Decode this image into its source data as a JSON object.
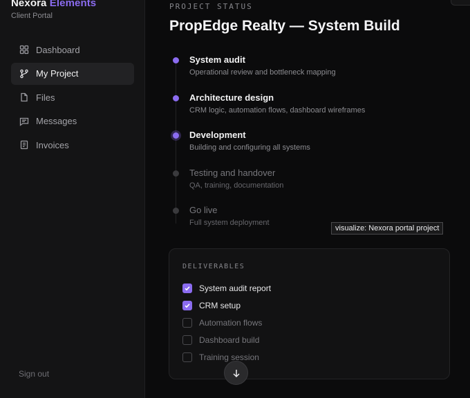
{
  "brand": {
    "name": "Nexora",
    "accent_name": "Elements",
    "subtitle": "Client Portal"
  },
  "nav": {
    "items": [
      {
        "label": "Dashboard",
        "icon": "grid-icon",
        "active": false
      },
      {
        "label": "My Project",
        "icon": "branch-icon",
        "active": true
      },
      {
        "label": "Files",
        "icon": "file-icon",
        "active": false
      },
      {
        "label": "Messages",
        "icon": "message-icon",
        "active": false
      },
      {
        "label": "Invoices",
        "icon": "invoice-icon",
        "active": false
      }
    ],
    "sign_out": "Sign out"
  },
  "main": {
    "eyebrow": "PROJECT STATUS",
    "title": "PropEdge Realty — System Build",
    "steps": [
      {
        "title": "System audit",
        "desc": "Operational review and bottleneck mapping",
        "status": "done"
      },
      {
        "title": "Architecture design",
        "desc": "CRM logic, automation flows, dashboard wireframes",
        "status": "done"
      },
      {
        "title": "Development",
        "desc": "Building and configuring all systems",
        "status": "current"
      },
      {
        "title": "Testing and handover",
        "desc": "QA, training, documentation",
        "status": "pending"
      },
      {
        "title": "Go live",
        "desc": "Full system deployment",
        "status": "pending"
      }
    ],
    "tooltip": "visualize: Nexora portal project",
    "deliverables": {
      "label": "DELIVERABLES",
      "items": [
        {
          "label": "System audit report",
          "checked": true
        },
        {
          "label": "CRM setup",
          "checked": true
        },
        {
          "label": "Automation flows",
          "checked": false
        },
        {
          "label": "Dashboard build",
          "checked": false
        },
        {
          "label": "Training session",
          "checked": false
        }
      ]
    }
  },
  "colors": {
    "accent": "#8b6cf0",
    "background": "#0b0b0c",
    "sidebar": "#141415"
  }
}
